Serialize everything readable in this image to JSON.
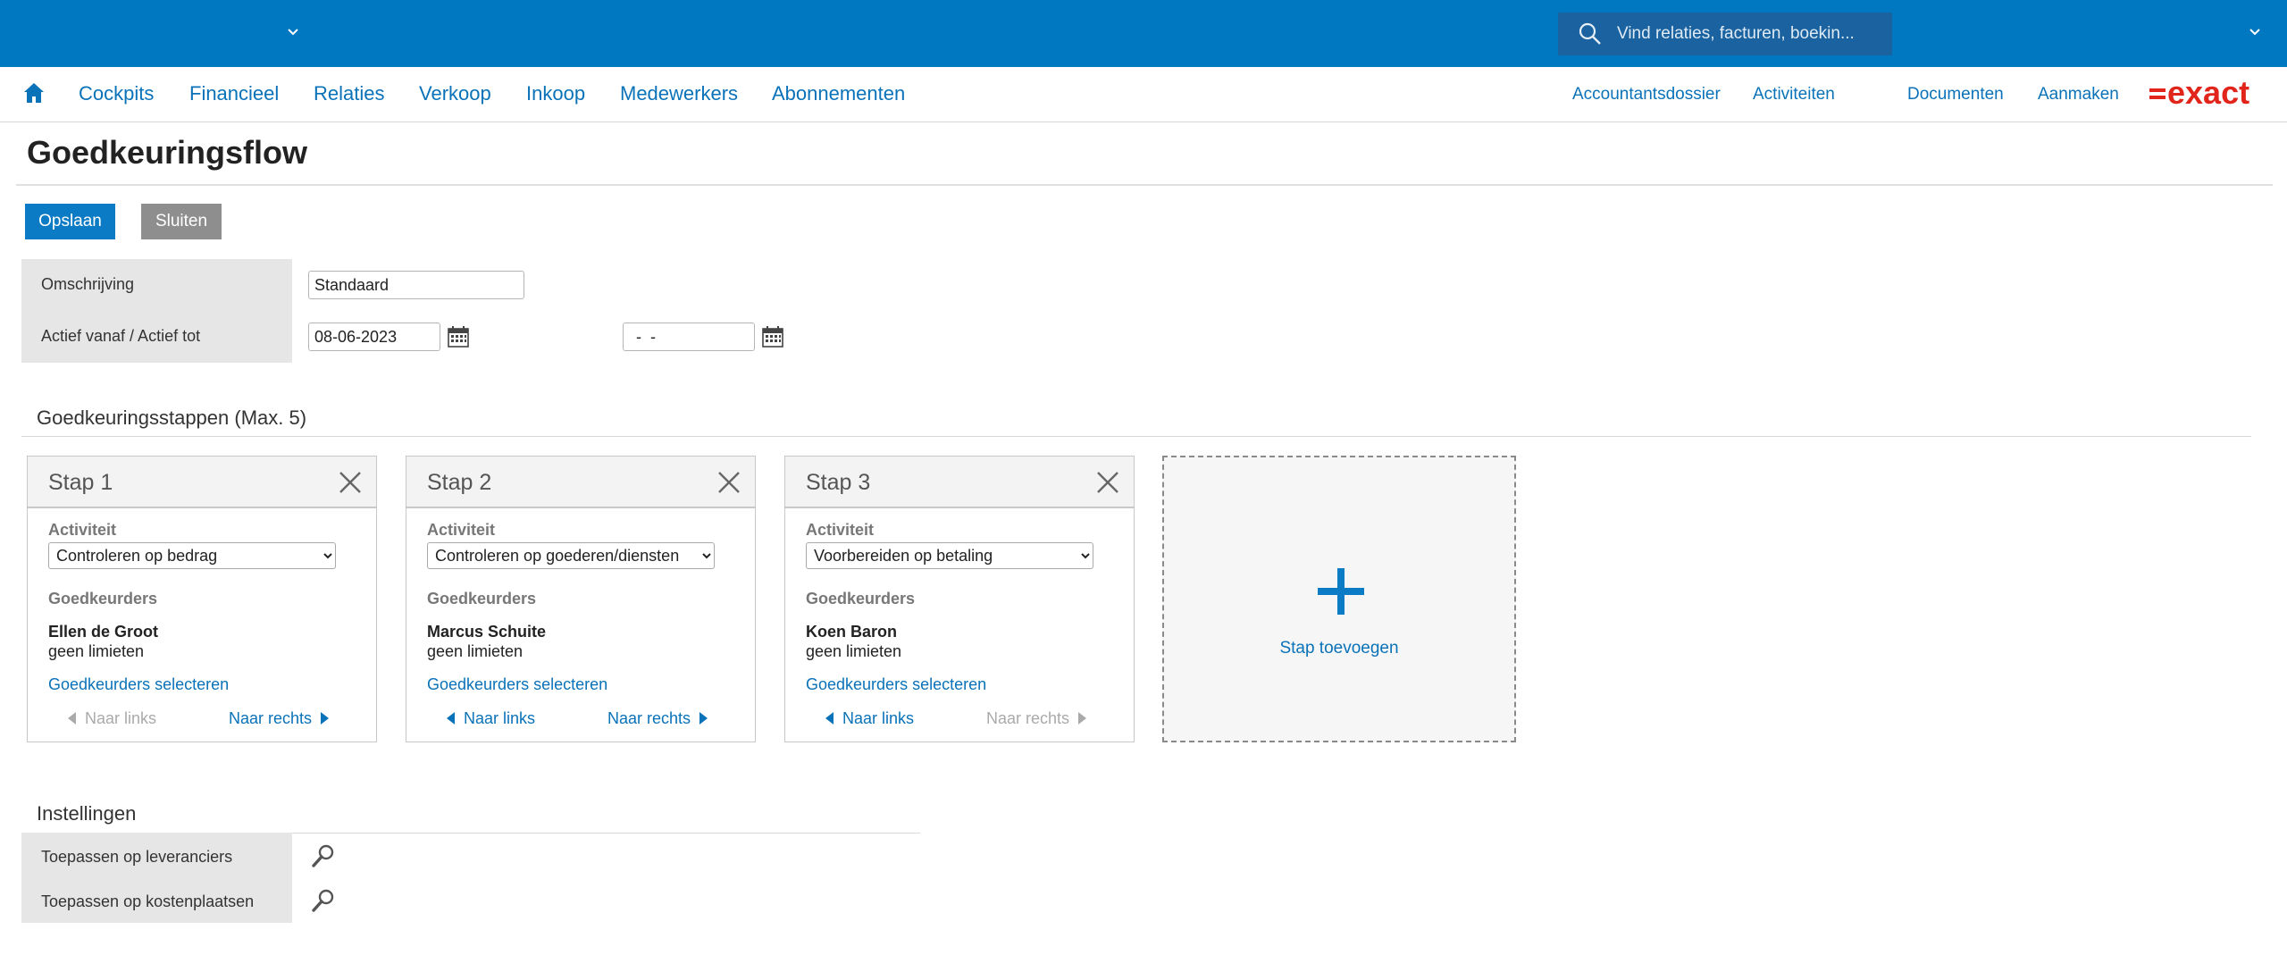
{
  "topbar": {
    "search_placeholder": "Vind relaties, facturen, boekin..."
  },
  "menu": {
    "items": [
      "Cockpits",
      "Financieel",
      "Relaties",
      "Verkoop",
      "Inkoop",
      "Medewerkers",
      "Abonnementen"
    ],
    "right_items": [
      "Accountantsdossier",
      "Activiteiten",
      "Documenten",
      "Aanmaken"
    ],
    "logo": "exact"
  },
  "page": {
    "title": "Goedkeuringsflow"
  },
  "toolbar": {
    "save_label": "Opslaan",
    "close_label": "Sluiten"
  },
  "form": {
    "description_label": "Omschrijving",
    "description_value": "Standaard",
    "active_label": "Actief vanaf / Actief tot",
    "active_from": "08-06-2023",
    "active_to": "-  -"
  },
  "steps_section": {
    "title": "Goedkeuringsstappen (Max. 5)",
    "activity_label": "Activiteit",
    "approvers_label": "Goedkeurders",
    "select_link": "Goedkeurders selecteren",
    "left_label": "Naar links",
    "right_label": "Naar rechts",
    "add_label": "Stap toevoegen",
    "steps": [
      {
        "title": "Stap 1",
        "activity": "Controleren op bedrag",
        "approver": "Ellen de Groot",
        "limit": "geen limieten"
      },
      {
        "title": "Stap 2",
        "activity": "Controleren op goederen/diensten",
        "approver": "Marcus Schuite",
        "limit": "geen limieten"
      },
      {
        "title": "Stap 3",
        "activity": "Voorbereiden op betaling",
        "approver": "Koen Baron",
        "limit": "geen limieten"
      }
    ]
  },
  "settings": {
    "title": "Instellingen",
    "suppliers_label": "Toepassen op leveranciers",
    "costcenters_label": "Toepassen op kostenplaatsen"
  },
  "colors": {
    "brand_blue": "#0078c1",
    "link_blue": "#0a72b8",
    "logo_red": "#e1251b"
  }
}
